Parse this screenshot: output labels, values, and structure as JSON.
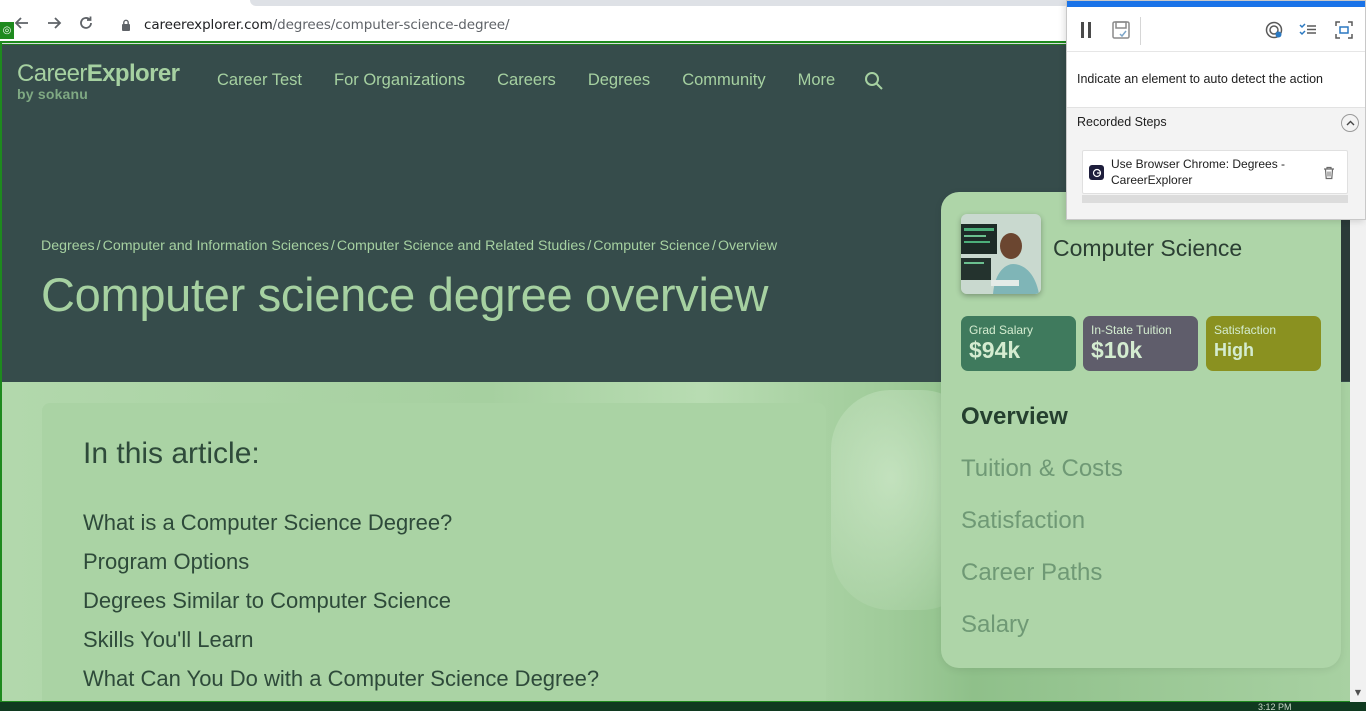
{
  "browser": {
    "url_domain": "careerexplorer.com",
    "url_path": "/degrees/computer-science-degree/"
  },
  "site": {
    "logo_main_light": "Career",
    "logo_main_bold": "Explorer",
    "logo_sub": "by sokanu",
    "nav": [
      "Career Test",
      "For Organizations",
      "Careers",
      "Degrees",
      "Community",
      "More"
    ]
  },
  "page": {
    "breadcrumb": [
      "Degrees",
      "Computer and Information Sciences",
      "Computer Science and Related Studies",
      "Computer Science",
      "Overview"
    ],
    "breadcrumb_separator": "/",
    "title": "Computer science degree overview"
  },
  "toc": {
    "heading": "In this article:",
    "items": [
      "What is a Computer Science Degree?",
      "Program Options",
      "Degrees Similar to Computer Science",
      "Skills You'll Learn",
      "What Can You Do with a Computer Science Degree?"
    ]
  },
  "degree_card": {
    "name": "Computer Science",
    "stats": [
      {
        "label": "Grad Salary",
        "value": "$94k",
        "color": "#3f7a5d"
      },
      {
        "label": "In-State Tuition",
        "value": "$10k",
        "color": "#5f5d6b"
      },
      {
        "label": "Satisfaction",
        "value": "High",
        "color": "#8a9120"
      }
    ],
    "sections": [
      "Overview",
      "Tuition & Costs",
      "Satisfaction",
      "Career Paths",
      "Salary"
    ],
    "active_section": "Overview"
  },
  "recorder": {
    "hint": "Indicate an element to auto detect the action",
    "recorded_title": "Recorded Steps",
    "steps": [
      "Use Browser Chrome: Degrees - CareerExplorer"
    ]
  },
  "taskbar": {
    "clock": "3:12 PM"
  },
  "colors": {
    "header_bg": "#364c4b",
    "accent_green": "#a6d1a1",
    "recorder_outline": "#1e8a1e"
  }
}
